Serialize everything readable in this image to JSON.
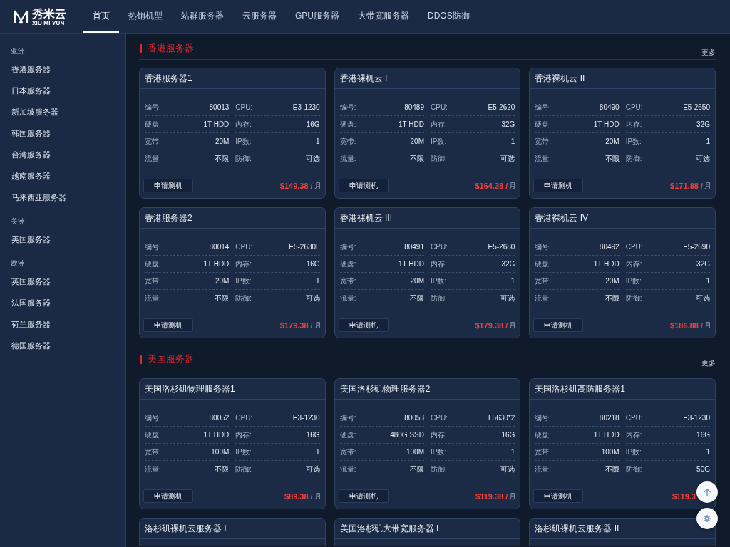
{
  "header": {
    "logo": {
      "name": "秀米云",
      "subtitle": "XIU MI YUN"
    },
    "nav": [
      {
        "label": "首页",
        "selected": true
      },
      {
        "label": "热销机型",
        "selected": false
      },
      {
        "label": "站群服务器",
        "selected": false
      },
      {
        "label": "云服务器",
        "selected": false
      },
      {
        "label": "GPU服务器",
        "selected": false
      },
      {
        "label": "大带宽服务器",
        "selected": false
      },
      {
        "label": "DDOS防御",
        "selected": false
      }
    ]
  },
  "sidebar": {
    "groups": [
      {
        "label": "亚洲",
        "items": [
          "香港服务器",
          "日本服务器",
          "新加坡服务器",
          "韩国服务器",
          "台湾服务器",
          "越南服务器",
          "马来西亚服务器"
        ]
      },
      {
        "label": "美洲",
        "items": [
          "美国服务器"
        ]
      },
      {
        "label": "欧洲",
        "items": [
          "英国服务器",
          "法国服务器",
          "荷兰服务器",
          "德国服务器"
        ]
      }
    ]
  },
  "sections": [
    {
      "title": "香港服务器",
      "more": "更多",
      "cards": [
        {
          "title": "香港服务器1",
          "specs": [
            {
              "label": "编号:",
              "value": "80013"
            },
            {
              "label": "CPU:",
              "value": "E3-1230"
            },
            {
              "label": "硬盘:",
              "value": "1T HDD"
            },
            {
              "label": "内存:",
              "value": "16G"
            },
            {
              "label": "宽带:",
              "value": "20M"
            },
            {
              "label": "IP数:",
              "value": "1"
            },
            {
              "label": "流量:",
              "value": "不限"
            },
            {
              "label": "防御:",
              "value": "可选"
            }
          ],
          "button": "申请测机",
          "price": "$149.38 /",
          "unit": "月"
        },
        {
          "title": "香港裸机云 I",
          "specs": [
            {
              "label": "编号:",
              "value": "80489"
            },
            {
              "label": "CPU:",
              "value": "E5-2620"
            },
            {
              "label": "硬盘:",
              "value": "1T HDD"
            },
            {
              "label": "内存:",
              "value": "32G"
            },
            {
              "label": "宽带:",
              "value": "20M"
            },
            {
              "label": "IP数:",
              "value": "1"
            },
            {
              "label": "流量:",
              "value": "不限"
            },
            {
              "label": "防御:",
              "value": "可选"
            }
          ],
          "button": "申请测机",
          "price": "$164.38 /",
          "unit": "月"
        },
        {
          "title": "香港裸机云 II",
          "specs": [
            {
              "label": "编号:",
              "value": "80490"
            },
            {
              "label": "CPU:",
              "value": "E5-2650"
            },
            {
              "label": "硬盘:",
              "value": "1T HDD"
            },
            {
              "label": "内存:",
              "value": "32G"
            },
            {
              "label": "宽带:",
              "value": "20M"
            },
            {
              "label": "IP数:",
              "value": "1"
            },
            {
              "label": "流量:",
              "value": "不限"
            },
            {
              "label": "防御:",
              "value": "可选"
            }
          ],
          "button": "申请测机",
          "price": "$171.88 /",
          "unit": "月"
        },
        {
          "title": "香港服务器2",
          "specs": [
            {
              "label": "编号:",
              "value": "80014"
            },
            {
              "label": "CPU:",
              "value": "E5-2630L"
            },
            {
              "label": "硬盘:",
              "value": "1T HDD"
            },
            {
              "label": "内存:",
              "value": "16G"
            },
            {
              "label": "宽带:",
              "value": "20M"
            },
            {
              "label": "IP数:",
              "value": "1"
            },
            {
              "label": "流量:",
              "value": "不限"
            },
            {
              "label": "防御:",
              "value": "可选"
            }
          ],
          "button": "申请测机",
          "price": "$179.38 /",
          "unit": "月"
        },
        {
          "title": "香港裸机云 III",
          "specs": [
            {
              "label": "编号:",
              "value": "80491"
            },
            {
              "label": "CPU:",
              "value": "E5-2680"
            },
            {
              "label": "硬盘:",
              "value": "1T HDD"
            },
            {
              "label": "内存:",
              "value": "32G"
            },
            {
              "label": "宽带:",
              "value": "20M"
            },
            {
              "label": "IP数:",
              "value": "1"
            },
            {
              "label": "流量:",
              "value": "不限"
            },
            {
              "label": "防御:",
              "value": "可选"
            }
          ],
          "button": "申请测机",
          "price": "$179.38 /",
          "unit": "月"
        },
        {
          "title": "香港裸机云 IV",
          "specs": [
            {
              "label": "编号:",
              "value": "80492"
            },
            {
              "label": "CPU:",
              "value": "E5-2690"
            },
            {
              "label": "硬盘:",
              "value": "1T HDD"
            },
            {
              "label": "内存:",
              "value": "32G"
            },
            {
              "label": "宽带:",
              "value": "20M"
            },
            {
              "label": "IP数:",
              "value": "1"
            },
            {
              "label": "流量:",
              "value": "不限"
            },
            {
              "label": "防御:",
              "value": "可选"
            }
          ],
          "button": "申请测机",
          "price": "$186.88 /",
          "unit": "月"
        }
      ]
    },
    {
      "title": "美国服务器",
      "more": "更多",
      "cards": [
        {
          "title": "美国洛杉矶物理服务器1",
          "specs": [
            {
              "label": "编号:",
              "value": "80052"
            },
            {
              "label": "CPU:",
              "value": "E3-1230"
            },
            {
              "label": "硬盘:",
              "value": "1T HDD"
            },
            {
              "label": "内存:",
              "value": "16G"
            },
            {
              "label": "宽带:",
              "value": "100M"
            },
            {
              "label": "IP数:",
              "value": "1"
            },
            {
              "label": "流量:",
              "value": "不限"
            },
            {
              "label": "防御:",
              "value": "可选"
            }
          ],
          "button": "申请测机",
          "price": "$89.38 /",
          "unit": "月"
        },
        {
          "title": "美国洛杉矶物理服务器2",
          "specs": [
            {
              "label": "编号:",
              "value": "80053"
            },
            {
              "label": "CPU:",
              "value": "L5630*2"
            },
            {
              "label": "硬盘:",
              "value": "480G SSD"
            },
            {
              "label": "内存:",
              "value": "16G"
            },
            {
              "label": "宽带:",
              "value": "100M"
            },
            {
              "label": "IP数:",
              "value": "1"
            },
            {
              "label": "流量:",
              "value": "不限"
            },
            {
              "label": "防御:",
              "value": "可选"
            }
          ],
          "button": "申请测机",
          "price": "$119.38 /",
          "unit": "月"
        },
        {
          "title": "美国洛杉矶高防服务器1",
          "specs": [
            {
              "label": "编号:",
              "value": "80218"
            },
            {
              "label": "CPU:",
              "value": "E3-1230"
            },
            {
              "label": "硬盘:",
              "value": "1T HDD"
            },
            {
              "label": "内存:",
              "value": "16G"
            },
            {
              "label": "宽带:",
              "value": "100M"
            },
            {
              "label": "IP数:",
              "value": "1"
            },
            {
              "label": "流量:",
              "value": "不限"
            },
            {
              "label": "防御:",
              "value": "50G"
            }
          ],
          "button": "申请测机",
          "price": "$119.3"
        },
        {
          "title": "洛杉矶裸机云服务器 I"
        },
        {
          "title": "美国洛杉矶大带宽服务器 I"
        },
        {
          "title": "洛杉矶裸机云服务器 II"
        }
      ]
    }
  ]
}
